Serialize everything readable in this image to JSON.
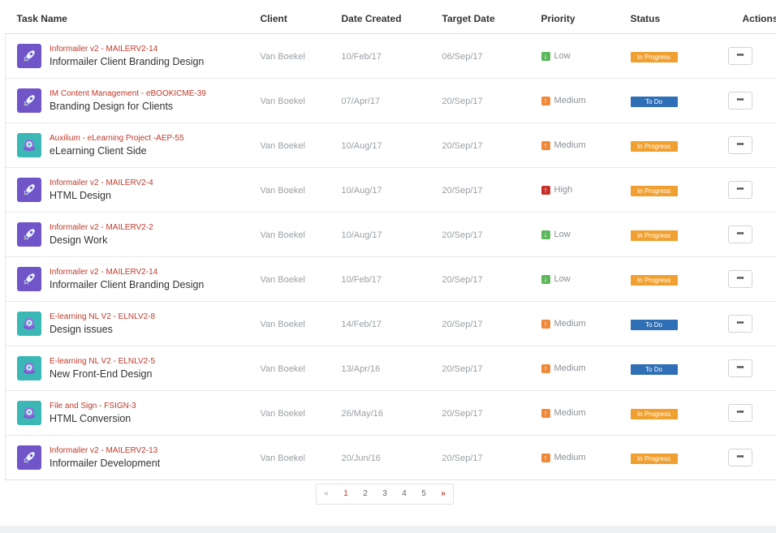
{
  "headers": {
    "task": "Task Name",
    "client": "Client",
    "created": "Date Created",
    "target": "Target Date",
    "priority": "Priority",
    "status": "Status",
    "actions": "Actions"
  },
  "rows": [
    {
      "avatar": "rocket-icon",
      "key": "Informailer v2 - MAILERV2-14",
      "name": "Informailer Client Branding Design",
      "client": "Van Boekel",
      "created": "10/Feb/17",
      "target": "06/Sep/17",
      "priority": "Low",
      "priority_icon": "arrow-down-icon",
      "status": "In Progress",
      "actions": "•••"
    },
    {
      "avatar": "rocket-icon",
      "key": "IM Content Management - eBOOKICME-39",
      "name": "Branding Design for Clients",
      "client": "Van Boekel",
      "created": "07/Apr/17",
      "target": "20/Sep/17",
      "priority": "Medium",
      "priority_icon": "arrow-up-icon",
      "status": "To Do",
      "actions": "•••"
    },
    {
      "avatar": "robot-icon",
      "key": "Auxilium - eLearning Project -AEP-55",
      "name": "eLearning Client Side",
      "client": "Van Boekel",
      "created": "10/Aug/17",
      "target": "20/Sep/17",
      "priority": "Medium",
      "priority_icon": "arrow-up-icon",
      "status": "In Progress",
      "actions": "•••"
    },
    {
      "avatar": "rocket-icon",
      "key": "Informailer v2 - MAILERV2-4",
      "name": "HTML Design",
      "client": "Van Boekel",
      "created": "10/Aug/17",
      "target": "20/Sep/17",
      "priority": "High",
      "priority_icon": "arrow-up-icon",
      "status": "In Progress",
      "actions": "•••"
    },
    {
      "avatar": "rocket-icon",
      "key": "Informailer v2 - MAILERV2-2",
      "name": "Design Work",
      "client": "Van Boekel",
      "created": "10/Aug/17",
      "target": "20/Sep/17",
      "priority": "Low",
      "priority_icon": "arrow-down-icon",
      "status": "In Progress",
      "actions": "•••"
    },
    {
      "avatar": "rocket-icon",
      "key": "Informailer v2 - MAILERV2-14",
      "name": "Informailer Client Branding Design",
      "client": "Van Boekel",
      "created": "10/Feb/17",
      "target": "20/Sep/17",
      "priority": "Low",
      "priority_icon": "arrow-down-icon",
      "status": "In Progress",
      "actions": "•••"
    },
    {
      "avatar": "robot-icon",
      "key": "E-learning NL V2 - ELNLV2-8",
      "name": "Design issues",
      "client": "Van Boekel",
      "created": "14/Feb/17",
      "target": "20/Sep/17",
      "priority": "Medium",
      "priority_icon": "arrow-up-icon",
      "status": "To Do",
      "actions": "•••"
    },
    {
      "avatar": "robot-icon",
      "key": "E-learning NL V2 - ELNLV2-5",
      "name": "New Front-End Design",
      "client": "Van Boekel",
      "created": "13/Apr/16",
      "target": "20/Sep/17",
      "priority": "Medium",
      "priority_icon": "arrow-up-icon",
      "status": "To Do",
      "actions": "•••"
    },
    {
      "avatar": "robot-icon",
      "key": "File and Sign - FSIGN-3",
      "name": "HTML Conversion",
      "client": "Van Boekel",
      "created": "26/May/16",
      "target": "20/Sep/17",
      "priority": "Medium",
      "priority_icon": "arrow-up-icon",
      "status": "In Progress",
      "actions": "•••"
    },
    {
      "avatar": "rocket-icon",
      "key": "Informailer v2 - MAILERV2-13",
      "name": "Informailer Development",
      "client": "Van Boekel",
      "created": "20/Jun/16",
      "target": "20/Sep/17",
      "priority": "Medium",
      "priority_icon": "arrow-up-icon",
      "status": "In Progress",
      "actions": "•••"
    }
  ],
  "colors": {
    "priority": {
      "Low": "#5cb85c",
      "Medium": "#f0883a",
      "High": "#c9302c"
    },
    "status": {
      "In Progress": "#f0a030",
      "To Do": "#2f6fb5"
    },
    "accent": "#c0392b"
  },
  "pagination": {
    "prev": "«",
    "pages": [
      "1",
      "2",
      "3",
      "4",
      "5"
    ],
    "active": "1",
    "next": "»"
  }
}
